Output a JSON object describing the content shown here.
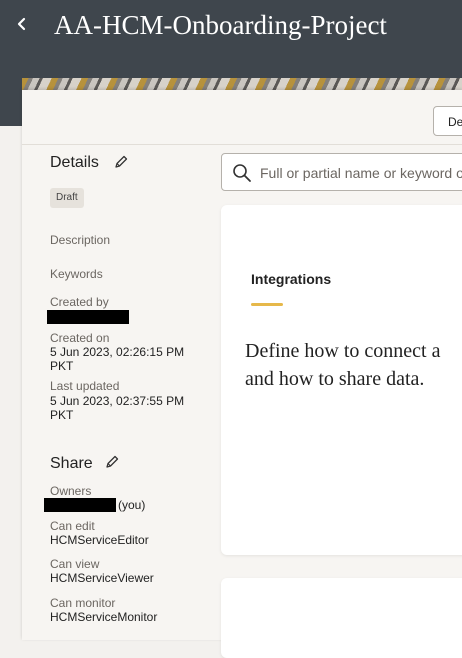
{
  "header": {
    "back_icon": "chevron-left-icon",
    "title": "AA-HCM-Onboarding-Project"
  },
  "toolbar": {
    "button_label": "De"
  },
  "details": {
    "title": "Details",
    "status_badge": "Draft",
    "description_label": "Description",
    "keywords_label": "Keywords",
    "created_by_label": "Created by",
    "created_on_label": "Created on",
    "created_on_value_line1": "5 Jun 2023, 02:26:15 PM",
    "created_on_value_line2": "PKT",
    "last_updated_label": "Last updated",
    "last_updated_value_line1": "5 Jun 2023, 02:37:55 PM",
    "last_updated_value_line2": "PKT"
  },
  "share": {
    "title": "Share",
    "owners_label": "Owners",
    "owners_suffix": "(you)",
    "can_edit_label": "Can edit",
    "can_edit_value": "HCMServiceEditor",
    "can_view_label": "Can view",
    "can_view_value": "HCMServiceViewer",
    "can_monitor_label": "Can monitor",
    "can_monitor_value": "HCMServiceMonitor"
  },
  "search": {
    "placeholder": "Full or partial name or keyword o"
  },
  "integrations_card": {
    "heading": "Integrations",
    "text_line1": "Define how to connect a",
    "text_line2": "and how to share data."
  },
  "colors": {
    "header_bg": "#3f464d",
    "accent": "#e6b84a"
  }
}
